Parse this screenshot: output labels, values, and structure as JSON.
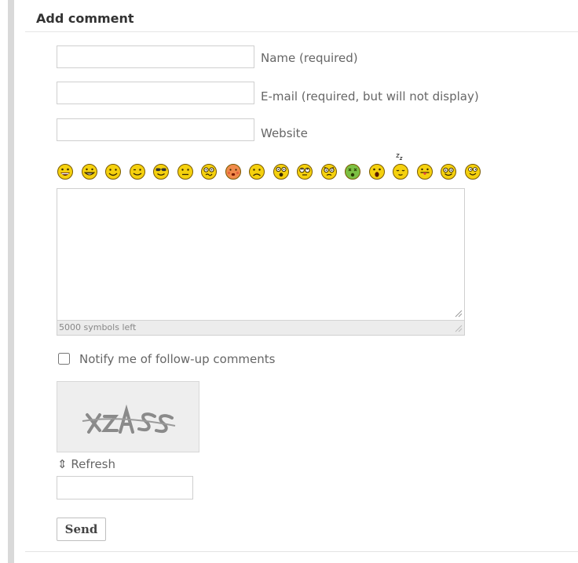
{
  "form": {
    "title": "Add comment",
    "fields": [
      {
        "id": "name",
        "label": "Name (required)",
        "value": "",
        "placeholder": ""
      },
      {
        "id": "email",
        "label": "E-mail (required, but will not display)",
        "value": "",
        "placeholder": ""
      },
      {
        "id": "website",
        "label": "Website",
        "value": "",
        "placeholder": ""
      }
    ],
    "smileys": [
      "laugh-smiley-icon",
      "grin-smiley-icon",
      "smile-smiley-icon",
      "wink-smiley-icon",
      "cool-smiley-icon",
      "neutral-smiley-icon",
      "confused-smiley-icon",
      "blush-smiley-icon",
      "sad-smiley-icon",
      "shocked-smiley-icon",
      "rolleyes-smiley-icon",
      "worried-smiley-icon",
      "sick-smiley-icon",
      "surprised-smiley-icon",
      "sleepy-smiley-icon",
      "tongue-smiley-icon",
      "happy-smiley-icon",
      "cheeky-smiley-icon"
    ],
    "comment": {
      "value": "",
      "counter": "5000 symbols left"
    },
    "notify_label": "Notify me of follow-up comments",
    "notify_checked": false,
    "captcha": {
      "text": "xZASS",
      "refresh_label": "Refresh",
      "value": ""
    },
    "send_label": "Send",
    "colors": {
      "smiley_fill": "#f5d10e",
      "smiley_outline": "#7a5a00",
      "sick_fill": "#7cc043",
      "blush_fill": "#f08a4b",
      "shocked_fill": "#d8c0a0"
    }
  }
}
